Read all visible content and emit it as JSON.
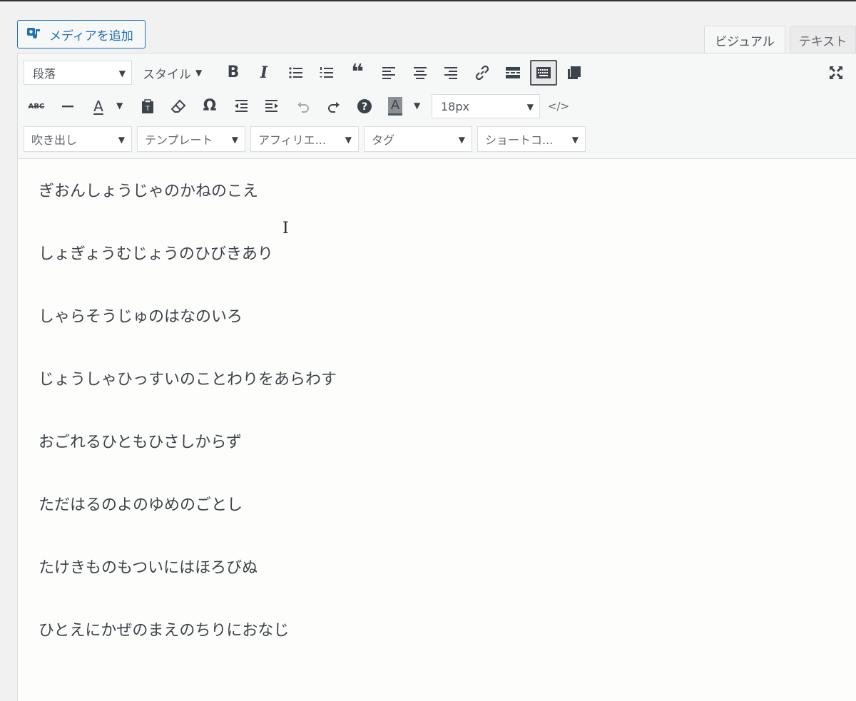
{
  "media": {
    "label": "メディアを追加",
    "icon": "media-upload-icon"
  },
  "tabs": {
    "visual": "ビジュアル",
    "text": "テキスト"
  },
  "toolbar": {
    "format_select": "段落",
    "style_select": "スタイル",
    "font_size": "18px",
    "row3": {
      "balloon": "吹き出し",
      "template": "テンプレート",
      "affiliate": "アフィリエ...",
      "tag": "タグ",
      "shortcode": "ショートコ..."
    },
    "glyphs": {
      "bold": "B",
      "italic": "I",
      "quote": "❝",
      "strike": "ABC",
      "text_color": "A",
      "omega": "Ω",
      "help": "?",
      "bg_color": "A",
      "code": "</>"
    }
  },
  "content": {
    "lines": [
      "ぎおんしょうじゃのかねのこえ",
      "しょぎょうむじょうのひびきあり",
      "しゃらそうじゅのはなのいろ",
      "じょうしゃひっすいのことわりをあらわす",
      "おごれるひともひさしからず",
      "ただはるのよのゆめのごとし",
      "たけきものもついにはほろびぬ",
      "ひとえにかぜのまえのちりにおなじ"
    ]
  },
  "colors": {
    "accent": "#2271b1",
    "toolbar_bg": "#f6f7f7",
    "editor_bg": "#fdfdfb"
  }
}
